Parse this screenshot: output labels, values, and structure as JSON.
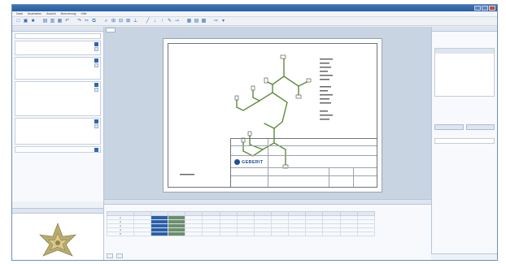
{
  "app": {
    "title": ""
  },
  "menu": [
    "Datei",
    "Bearbeiten",
    "Ansicht",
    "Berechnung",
    "Hilfe"
  ],
  "toolbar": [
    "new",
    "open",
    "save",
    "print",
    "undo",
    "redo",
    "cut",
    "copy",
    "paste",
    "zoom-in",
    "zoom-out",
    "pipe",
    "fitting",
    "valve",
    "measure",
    "calc",
    "report",
    "help"
  ],
  "left_panel": {
    "header": "",
    "filter_placeholder": "",
    "groups": [
      {
        "title": "",
        "items": [
          "",
          ""
        ]
      },
      {
        "title": "",
        "items": [
          "",
          "",
          "",
          ""
        ]
      },
      {
        "title": "",
        "items": [
          "",
          "",
          "",
          "",
          "",
          "",
          ""
        ]
      },
      {
        "title": "",
        "items": [
          "",
          "",
          "",
          "",
          ""
        ]
      },
      {
        "title": "",
        "items": []
      }
    ],
    "footer_link": "",
    "tabs": [
      "",
      "",
      ""
    ],
    "preview_header": ""
  },
  "center": {
    "doc_tab": "",
    "logo_text": "GEBERIT"
  },
  "right_panel": {
    "header": "",
    "tabs": [
      "",
      ""
    ]
  },
  "bottom_panel": {
    "header": "",
    "columns": [
      "",
      "",
      "",
      "",
      "",
      "",
      "",
      "",
      "",
      "",
      "",
      "",
      "",
      "",
      ""
    ],
    "rows": [
      [
        "1",
        "",
        "",
        "",
        "",
        "",
        "",
        "",
        "",
        "",
        "",
        "",
        "",
        "",
        ""
      ],
      [
        "2",
        "",
        "",
        "",
        "",
        "",
        "",
        "",
        "",
        "",
        "",
        "",
        "",
        "",
        ""
      ],
      [
        "3",
        "",
        "",
        "",
        "",
        "",
        "",
        "",
        "",
        "",
        "",
        "",
        "",
        "",
        ""
      ],
      [
        "4",
        "",
        "",
        "",
        "",
        "",
        "",
        "",
        "",
        "",
        "",
        "",
        "",
        "",
        ""
      ],
      [
        "5",
        "",
        "",
        "",
        "",
        "",
        "",
        "",
        "",
        "",
        "",
        "",
        "",
        "",
        ""
      ]
    ],
    "tabs": [
      "",
      ""
    ]
  },
  "colors": {
    "accent": "#2f66b5",
    "title": "#2c5d9e",
    "pipe": "#5f8a3a"
  }
}
